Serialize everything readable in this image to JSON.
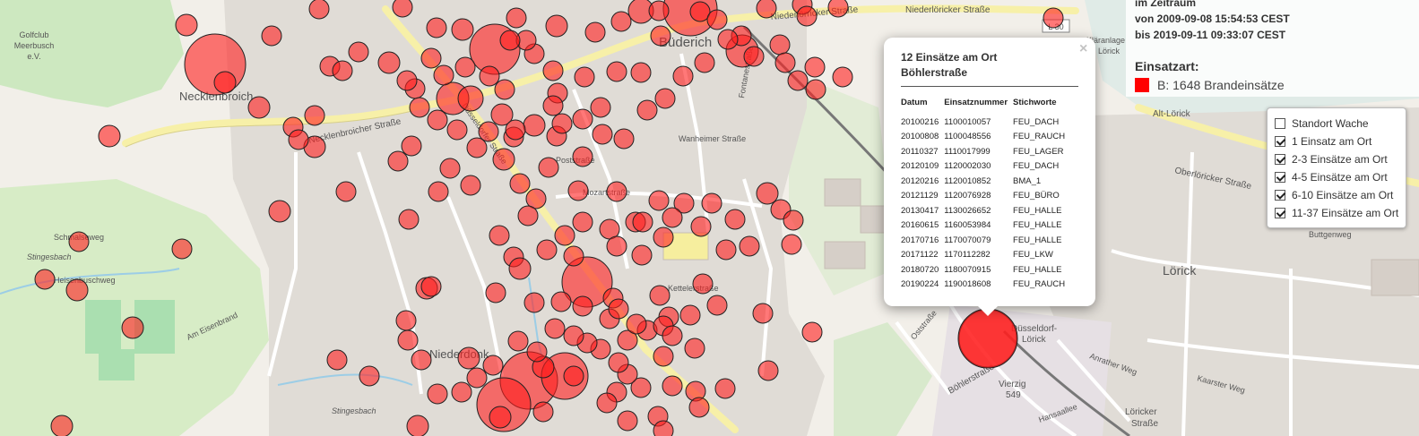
{
  "info": {
    "line1": "im Zeitraum",
    "line2": "von 2009-09-08 15:54:53 CEST",
    "line3": "bis 2019-09-11 09:33:07 CEST",
    "type_heading": "Einsatzart:",
    "type_value": "B: 1648 Brandeinsätze",
    "swatch_color": "#ff0000"
  },
  "layers": [
    {
      "label": "Standort Wache",
      "checked": false
    },
    {
      "label": "1 Einsatz am Ort",
      "checked": true
    },
    {
      "label": "2-3 Einsätze am Ort",
      "checked": true
    },
    {
      "label": "4-5 Einsätze am Ort",
      "checked": true
    },
    {
      "label": "6-10 Einsätze am Ort",
      "checked": true
    },
    {
      "label": "11-37 Einsätze am Ort",
      "checked": true
    }
  ],
  "popup": {
    "title_line1": "12 Einsätze am Ort",
    "title_line2": "Böhlerstraße",
    "close": "×",
    "columns": [
      "Datum",
      "Einsatznummer",
      "Stichworte"
    ],
    "rows": [
      [
        "20100216",
        "1100010057",
        "FEU_DACH"
      ],
      [
        "20100808",
        "1100048556",
        "FEU_RAUCH"
      ],
      [
        "20110327",
        "1110017999",
        "FEU_LAGER"
      ],
      [
        "20120109",
        "1120002030",
        "FEU_DACH"
      ],
      [
        "20120216",
        "1120010852",
        "BMA_1"
      ],
      [
        "20121129",
        "1120076928",
        "FEU_BÜRO"
      ],
      [
        "20130417",
        "1130026652",
        "FEU_HALLE"
      ],
      [
        "20160615",
        "1160053984",
        "FEU_HALLE"
      ],
      [
        "20170716",
        "1170070079",
        "FEU_HALLE"
      ],
      [
        "20171122",
        "1170112282",
        "FEU_LKW"
      ],
      [
        "20180720",
        "1180070915",
        "FEU_HALLE"
      ],
      [
        "20190224",
        "1190018608",
        "FEU_RAUCH"
      ]
    ]
  },
  "map_labels": {
    "golfclub1": "Golfclub",
    "golfclub2": "Meerbusch",
    "golfclub3": "e.V.",
    "necklenbroich": "Necklenbroich",
    "buederich": "Büderich",
    "niederdonk": "Niederdonk",
    "loerick": "Lörick",
    "alt_loerick": "Alt-Lörick",
    "duesseldorf_loerick1": "Düsseldorf-",
    "duesseldorf_loerick2": "Lörick",
    "loericker_strasse1": "Löricker",
    "loericker_strasse2": "Straße",
    "niederloericker": "Niederlörricker Straße",
    "niederloericker2": "Niederlöricker Straße",
    "oberloericker": "Oberlöricker Straße",
    "necklenbroicher": "Necklenbroicher Straße",
    "boehlerstrasse": "Böhlerstraße",
    "schmalseweg": "Schmalseweg",
    "heisenbuschweg": "Heisenbuschweg",
    "am_eisenbrand": "Am Eisenbrand",
    "stingesbach": "Stingesbach",
    "kettelerstrasse": "Kettelerstraße",
    "mozartstrasse": "Mozartstraße",
    "poststrasse": "Poststraße",
    "duckerstrasse": "Düsseldorfer Straße",
    "ostrasse": "Oststraße",
    "buttgenweg": "Buttgenweg",
    "vierzig": "Vierzig",
    "vierzig_num": "549",
    "l30": "L 30",
    "klaeranlage": "Kläranlage",
    "loerick_small": "Lörick",
    "anrather_weg": "Anrather Weg",
    "kaarster_weg": "Kaarster Weg",
    "hansaallee": "Hansaallee",
    "fontanestrasse": "Fontanestraße",
    "wanheimer": "Wanheimer Straße"
  }
}
